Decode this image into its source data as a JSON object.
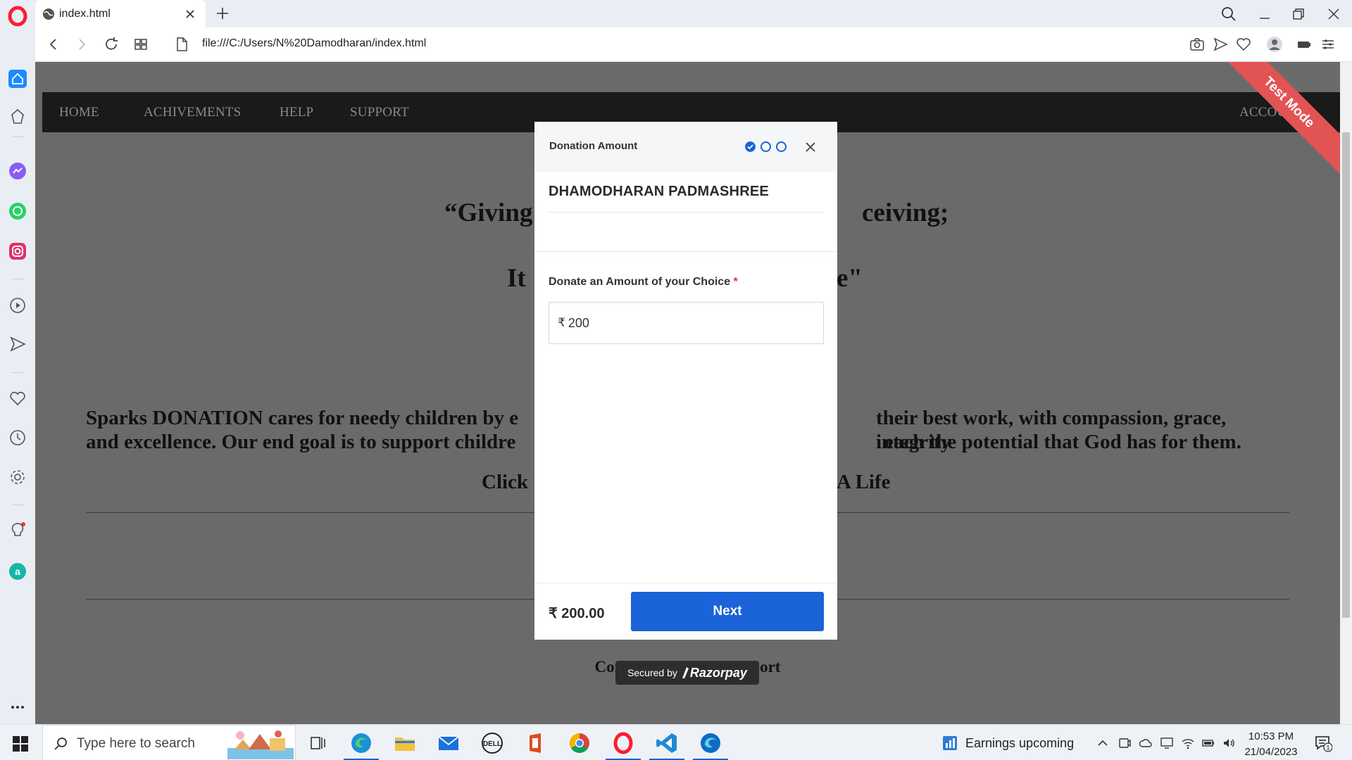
{
  "browser": {
    "tab_title": "index.html",
    "url": "file:///C:/Users/N%20Damodharan/index.html"
  },
  "site": {
    "nav": [
      "HOME",
      "ACHIVEMENTS",
      "HELP",
      "SUPPORT"
    ],
    "nav_right": "ACCOUNTS",
    "quote_line1": "“Giving",
    "quote_line1_end": "ceiving;",
    "quote_line2": "It",
    "quote_line2_end": "e\"",
    "para_left_1": "Sparks DONATION cares for needy children by e",
    "para_right_1": "their best work, with compassion, grace, integrity",
    "para_left_2": "and excellence. Our end goal is to support childre",
    "para_right_2": "each the potential that God has for them.",
    "click_left": "Click",
    "click_right": "A Life",
    "contact": "Contact Help And Support",
    "test_mode": "Test Mode"
  },
  "modal": {
    "title": "Donation Amount",
    "steps": [
      "done",
      "pending",
      "pending"
    ],
    "merchant": "DHAMODHARAN PADMASHREE",
    "field_label": "Donate an Amount of your Choice",
    "required_mark": "*",
    "currency_symbol": "₹",
    "amount_value": "200",
    "total": "₹ 200.00",
    "next_label": "Next",
    "secured_label": "Secured by",
    "secured_brand": "Razorpay"
  },
  "taskbar": {
    "search_placeholder": "Type here to search",
    "news": "Earnings upcoming",
    "time": "10:53 PM",
    "date": "21/04/2023",
    "notification_count": "1"
  },
  "colors": {
    "accent": "#1a63d8",
    "opera_red": "#ff1b2d",
    "ribbon": "#e25454",
    "overlay": "#6a6a6a"
  }
}
